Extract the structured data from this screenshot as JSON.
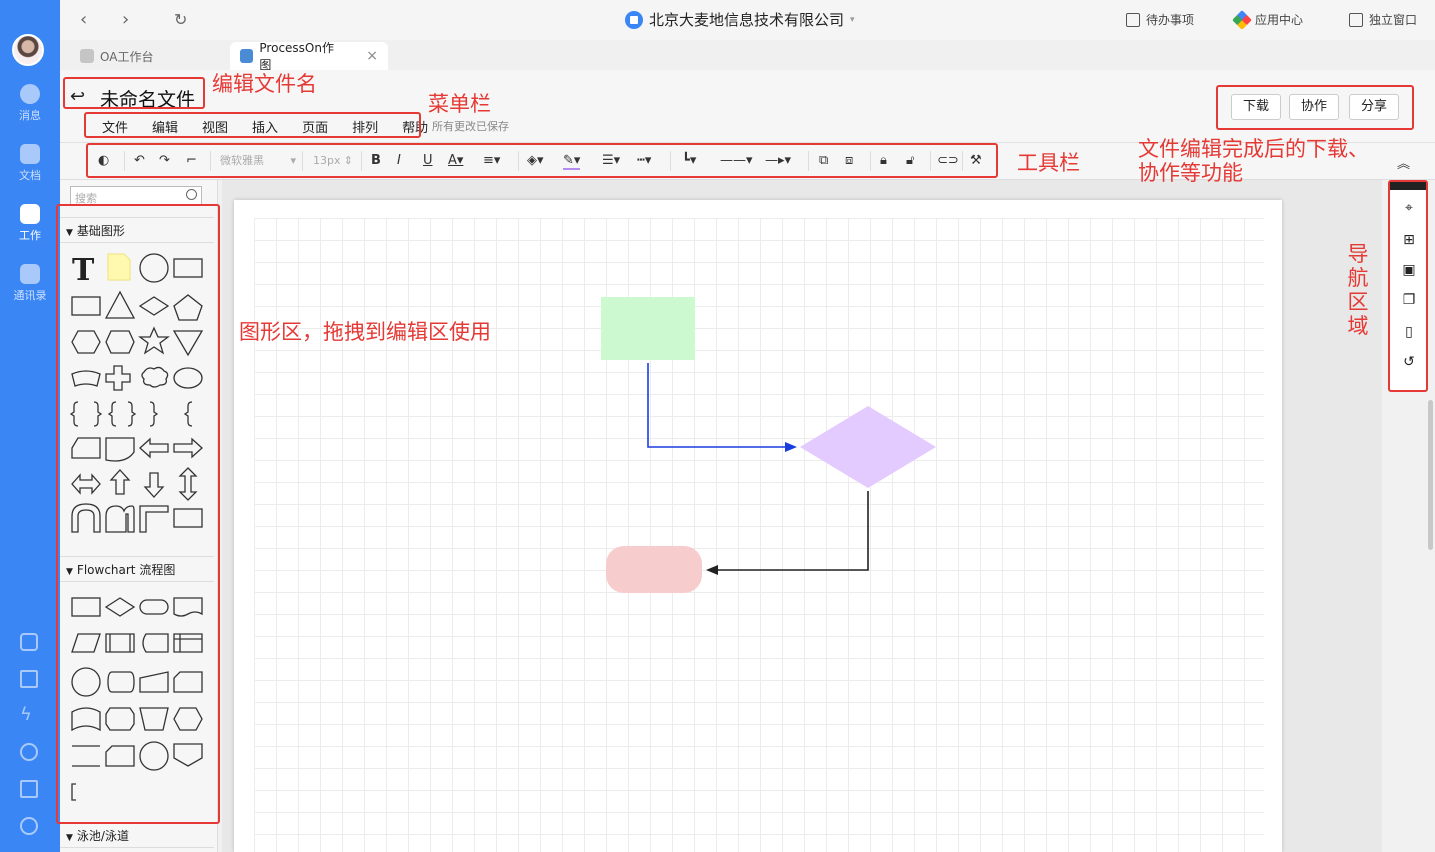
{
  "sidebar": {
    "items": [
      {
        "label": "消息"
      },
      {
        "label": "文档"
      },
      {
        "label": "工作"
      },
      {
        "label": "通讯录"
      }
    ],
    "bottom_icons": [
      "calendar-icon",
      "checklist-icon",
      "lightning-icon",
      "phone-icon",
      "mail-icon",
      "settings-flower-icon"
    ]
  },
  "topbar": {
    "company": "北京大麦地信息技术有限公司",
    "todo": "待办事项",
    "apps": "应用中心",
    "window": "独立窗口"
  },
  "tabs": [
    {
      "label": "OA工作台"
    },
    {
      "label": "ProcessOn作图",
      "close": "×"
    }
  ],
  "header": {
    "back": "↩",
    "file_name": "未命名文件",
    "menu": [
      "文件",
      "编辑",
      "视图",
      "插入",
      "页面",
      "排列",
      "帮助"
    ],
    "saved": "所有更改已保存",
    "buttons": {
      "download": "下载",
      "collab": "协作",
      "share": "分享"
    }
  },
  "toolbar": {
    "font": "微软雅黑",
    "size": "13px",
    "collapse": "︽"
  },
  "panel": {
    "search_placeholder": "搜索",
    "cat_basic": "基础图形",
    "cat_flow": "Flowchart 流程图",
    "cat_pool": "泳池/泳道"
  },
  "annotations": {
    "edit_name": "编辑文件名",
    "menubar": "菜单栏",
    "toolbar": "工具栏",
    "download": "文件编辑完成后的下载、",
    "download2": "协作等功能",
    "shapes": "图形区，拖拽到编辑区使用",
    "nav": "导航区域"
  },
  "colors": {
    "rail": "#3a86f4",
    "annotation": "#e53935",
    "green": "#ccf9cf",
    "purple": "#e4cbff",
    "pink": "#f7cccc",
    "blue_arrow": "#1a3de0"
  }
}
